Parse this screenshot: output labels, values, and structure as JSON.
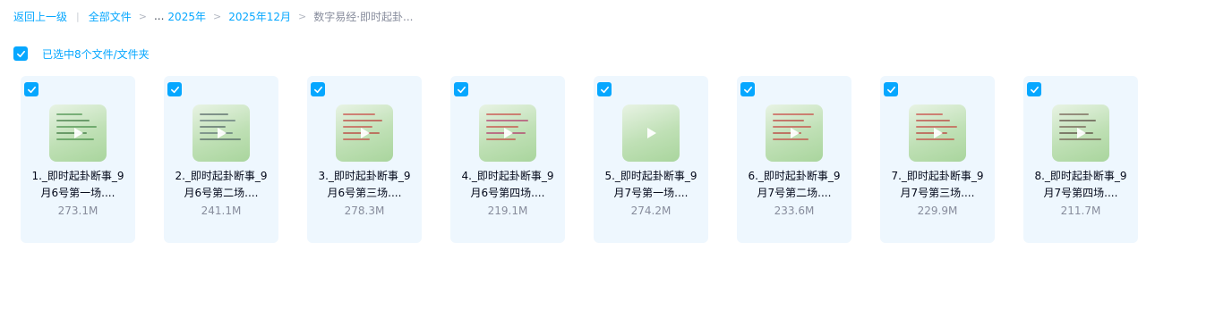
{
  "breadcrumb": {
    "back": "返回上一级",
    "all_files": "全部文件",
    "ellipsis": "...",
    "crumb_1": "2025年",
    "crumb_2": "2025年12月",
    "current": "数字易经·即时起卦..."
  },
  "selection": {
    "text": "已选中8个文件/文件夹",
    "checked": true
  },
  "colors": {
    "accent": "#06a7ff",
    "card_bg": "#eef7fe",
    "muted_text": "#878c9c",
    "primary_text": "#03081a"
  },
  "files": [
    {
      "name": "1._即时起卦断事_9月6号第一场....",
      "size": "273.1M",
      "checked": true,
      "icon": "video-thumbnail"
    },
    {
      "name": "2._即时起卦断事_9月6号第二场....",
      "size": "241.1M",
      "checked": true,
      "icon": "video-thumbnail"
    },
    {
      "name": "3._即时起卦断事_9月6号第三场....",
      "size": "278.3M",
      "checked": true,
      "icon": "video-thumbnail"
    },
    {
      "name": "4._即时起卦断事_9月6号第四场....",
      "size": "219.1M",
      "checked": true,
      "icon": "video-thumbnail"
    },
    {
      "name": "5._即时起卦断事_9月7号第一场....",
      "size": "274.2M",
      "checked": true,
      "icon": "video-thumbnail"
    },
    {
      "name": "6._即时起卦断事_9月7号第二场....",
      "size": "233.6M",
      "checked": true,
      "icon": "video-thumbnail"
    },
    {
      "name": "7._即时起卦断事_9月7号第三场....",
      "size": "229.9M",
      "checked": true,
      "icon": "video-thumbnail"
    },
    {
      "name": "8._即时起卦断事_9月7号第四场....",
      "size": "211.7M",
      "checked": true,
      "icon": "video-thumbnail"
    }
  ]
}
